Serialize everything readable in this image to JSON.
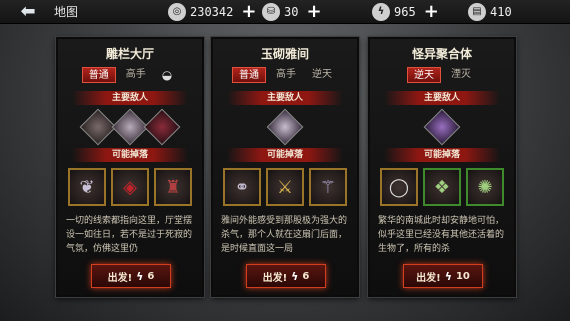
{
  "header": {
    "back_icon": "back-arrow-icon",
    "map_label": "地图",
    "resources": [
      {
        "icon": "coin-icon",
        "value": "230342"
      },
      {
        "icon": "ingot-icon",
        "value": "30"
      },
      {
        "icon": "lightning-icon",
        "value": "965"
      },
      {
        "icon": "ticket-icon",
        "value": "410"
      }
    ]
  },
  "cards": [
    {
      "title": "雕栏大厅",
      "difficulties": [
        "普通",
        "高手",
        ""
      ],
      "enemies_label": "主要敌人",
      "drops_label": "可能掉落",
      "description": "一切的线索都指向这里，厅堂摆设一如往日，若不是过于死寂的气氛，仿佛这里仍",
      "go_label": "出发!",
      "cost": "6"
    },
    {
      "title": "玉砌雅间",
      "difficulties": [
        "普通",
        "高手",
        "逆天"
      ],
      "enemies_label": "主要敌人",
      "drops_label": "可能掉落",
      "description": "雅间外能感受到那股极为强大的杀气，那个人就在这扇门后面，是时候直面这一局",
      "go_label": "出发!",
      "cost": "6"
    },
    {
      "title": "怪异聚合体",
      "difficulties": [
        "逆天",
        "湮灭"
      ],
      "enemies_label": "主要敌人",
      "drops_label": "可能掉落",
      "description": "繁华的南城此时却安静地可怕，似乎这里已经没有其他还活着的生物了，所有的杀",
      "go_label": "出发!",
      "cost": "10"
    }
  ]
}
